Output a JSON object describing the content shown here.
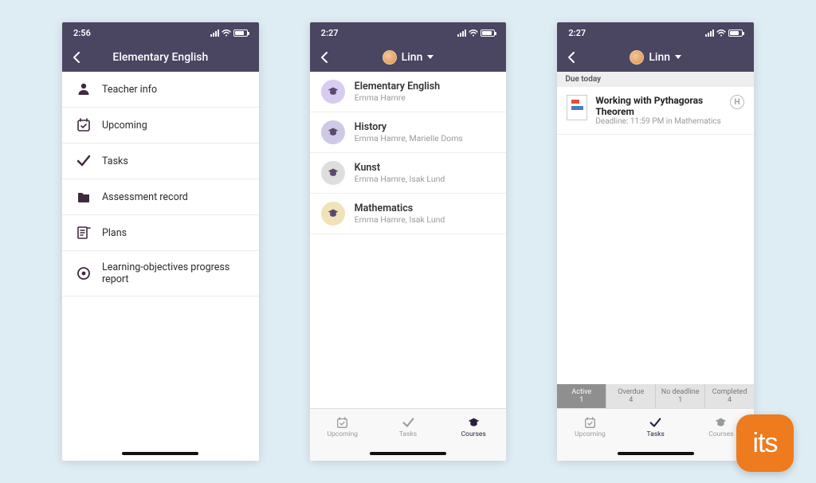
{
  "phone1": {
    "status_time": "2:56",
    "title": "Elementary English",
    "menu": [
      {
        "icon": "user-icon",
        "label": "Teacher info"
      },
      {
        "icon": "calendar-check-icon",
        "label": "Upcoming"
      },
      {
        "icon": "check-icon",
        "label": "Tasks"
      },
      {
        "icon": "folder-icon",
        "label": "Assessment record"
      },
      {
        "icon": "plans-icon",
        "label": "Plans"
      },
      {
        "icon": "target-icon",
        "label": "Learning-objectives progress report"
      }
    ]
  },
  "phone2": {
    "status_time": "2:27",
    "user_name": "Linn",
    "courses": [
      {
        "color": "#d8ccf0",
        "name": "Elementary English",
        "teachers": "Emma Hamre"
      },
      {
        "color": "#cfc9e6",
        "name": "History",
        "teachers": "Emma Hamre, Marielle Doms"
      },
      {
        "color": "#dedede",
        "name": "Kunst",
        "teachers": "Emma Hamre, Isak Lund"
      },
      {
        "color": "#f2e2b8",
        "name": "Mathematics",
        "teachers": "Emma Hamre, Isak Lund"
      }
    ],
    "tabs": [
      {
        "icon": "calendar-check-icon",
        "label": "Upcoming"
      },
      {
        "icon": "check-icon",
        "label": "Tasks"
      },
      {
        "icon": "grad-cap-icon",
        "label": "Courses",
        "active": true
      }
    ]
  },
  "phone3": {
    "status_time": "2:27",
    "user_name": "Linn",
    "section_header": "Due today",
    "task": {
      "title": "Working with Pythagoras Theorem",
      "subtitle": "Deadline: 11:59 PM in Mathematics",
      "badge": "H"
    },
    "segmented": [
      {
        "label": "Active",
        "count": "1",
        "active": true
      },
      {
        "label": "Overdue",
        "count": "4"
      },
      {
        "label": "No deadline",
        "count": "1"
      },
      {
        "label": "Completed",
        "count": "4"
      }
    ],
    "tabs": [
      {
        "icon": "calendar-check-icon",
        "label": "Upcoming"
      },
      {
        "icon": "check-icon",
        "label": "Tasks",
        "active": true
      },
      {
        "icon": "grad-cap-icon",
        "label": "Courses"
      }
    ]
  },
  "logo_text": "its"
}
